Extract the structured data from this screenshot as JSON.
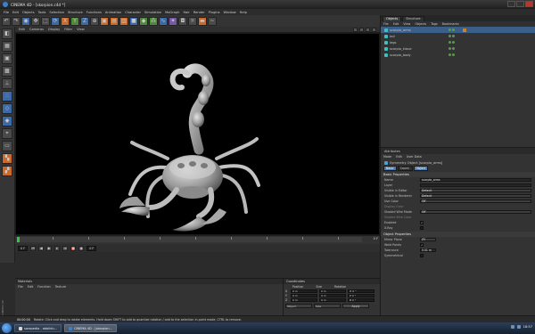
{
  "window": {
    "title": "CINEMA 4D - [skorpion.c4d *]"
  },
  "menubar": [
    "File",
    "Edit",
    "Objects",
    "Tools",
    "Selection",
    "Structure",
    "Functions",
    "Animation",
    "Character",
    "Simulation",
    "MoGraph",
    "Hair",
    "Render",
    "Plugins",
    "Window",
    "Help"
  ],
  "viewport": {
    "menu": [
      "Edit",
      "Cameras",
      "Display",
      "Filter",
      "View"
    ]
  },
  "timeline": {
    "end_frame": "0 F"
  },
  "transport": {
    "start": "0 F",
    "current": "0 F"
  },
  "materials": {
    "header": "Materials",
    "menu": [
      "File",
      "Edit",
      "Function",
      "Texture"
    ]
  },
  "coordinates": {
    "header": "Coordinates",
    "columns": [
      "Position",
      "Size",
      "Rotation"
    ],
    "rows": [
      {
        "axis": "X",
        "pos": "0 m",
        "size": "0 m",
        "rot": "H 0 °"
      },
      {
        "axis": "Y",
        "pos": "0 m",
        "size": "0 m",
        "rot": "P 0 °"
      },
      {
        "axis": "Z",
        "pos": "0 m",
        "size": "0 m",
        "rot": "B 0 °"
      }
    ],
    "mode": "Object",
    "size_mode": "Size",
    "apply": "Apply"
  },
  "object_manager": {
    "tabs": [
      "Objects",
      "Structure"
    ],
    "menu": [
      "File",
      "Edit",
      "View",
      "Objects",
      "Tags",
      "Bookmarks"
    ],
    "items": [
      {
        "name": "scorpio_arms",
        "color": "#3fbfbf",
        "selected": true
      },
      {
        "name": "tail",
        "color": "#3fbfbf",
        "selected": false
      },
      {
        "name": "legs",
        "color": "#3fbfbf",
        "selected": false
      },
      {
        "name": "scorpio_klaue",
        "color": "#3fbfbf",
        "selected": false
      },
      {
        "name": "scorpio_body",
        "color": "#3fbfbf",
        "selected": false
      }
    ]
  },
  "attributes": {
    "header": "Attributes",
    "menu": [
      "Mode",
      "Edit",
      "User Data"
    ],
    "object": "Symmetry Object [scorpio_arms]",
    "subtabs": [
      "Basic",
      "Coord.",
      "Object"
    ],
    "basic_title": "Basic Properties",
    "basic": [
      {
        "label": "Name",
        "value": "scorpio_arms",
        "type": "text"
      },
      {
        "label": "Layer",
        "value": "",
        "type": "text"
      },
      {
        "label": "Visible in Editor",
        "value": "Default",
        "type": "dd"
      },
      {
        "label": "Visible in Renderer",
        "value": "Default",
        "type": "dd"
      },
      {
        "label": "Use Color",
        "value": "Off",
        "type": "dd"
      },
      {
        "label": "Display Color",
        "value": "",
        "type": "dim"
      },
      {
        "label": "Shaded Wire Mode",
        "value": "Off",
        "type": "dd"
      },
      {
        "label": "Shaded Wire Color",
        "value": "",
        "type": "dim"
      },
      {
        "label": "Enabled",
        "value": "✓",
        "type": "cb"
      },
      {
        "label": "X-Ray",
        "value": "",
        "type": "cb"
      }
    ],
    "object_title": "Object Properties",
    "object_props": [
      {
        "label": "Mirror Plane",
        "value": "ZY",
        "type": "dd"
      },
      {
        "label": "Weld Points",
        "value": "✓",
        "type": "cb"
      },
      {
        "label": "Tolerance",
        "value": "0.01 m",
        "type": "text"
      },
      {
        "label": "Symmetrical",
        "value": "",
        "type": "cb"
      }
    ]
  },
  "status": {
    "time": "00:00:00",
    "text": "Rotate: Click and drag to rotate elements. Hold down SHIFT to add to quantize rotation / add to the selection in point mode, CTRL to remove."
  },
  "taskbar": {
    "items": [
      {
        "label": "sarapedia - abbildu...",
        "active": false,
        "color": "#d9d9d9"
      },
      {
        "label": "CINEMA 4D - [skorpion...",
        "active": true,
        "color": "#3a7fd0"
      }
    ],
    "clock": "18:57"
  },
  "side_label": "CINEMA 4D"
}
